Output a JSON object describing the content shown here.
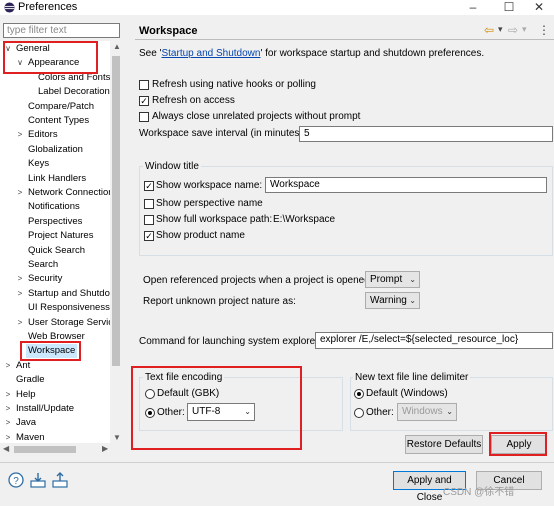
{
  "window": {
    "title": "Preferences",
    "minimize": "–",
    "maximize": "☐",
    "close": "✕"
  },
  "filter": {
    "placeholder": "type filter text"
  },
  "tree": [
    {
      "label": "General",
      "chev": "∨",
      "level": 0
    },
    {
      "label": "Appearance",
      "chev": "∨",
      "level": 1
    },
    {
      "label": "Colors and Fonts",
      "chev": "",
      "level": 2
    },
    {
      "label": "Label Decorations",
      "chev": "",
      "level": 2
    },
    {
      "label": "Compare/Patch",
      "chev": "",
      "level": 1
    },
    {
      "label": "Content Types",
      "chev": "",
      "level": 1
    },
    {
      "label": "Editors",
      "chev": ">",
      "level": 1
    },
    {
      "label": "Globalization",
      "chev": "",
      "level": 1
    },
    {
      "label": "Keys",
      "chev": "",
      "level": 1
    },
    {
      "label": "Link Handlers",
      "chev": "",
      "level": 1
    },
    {
      "label": "Network Connections",
      "chev": ">",
      "level": 1
    },
    {
      "label": "Notifications",
      "chev": "",
      "level": 1
    },
    {
      "label": "Perspectives",
      "chev": "",
      "level": 1
    },
    {
      "label": "Project Natures",
      "chev": "",
      "level": 1
    },
    {
      "label": "Quick Search",
      "chev": "",
      "level": 1
    },
    {
      "label": "Search",
      "chev": "",
      "level": 1
    },
    {
      "label": "Security",
      "chev": ">",
      "level": 1
    },
    {
      "label": "Startup and Shutdown",
      "chev": ">",
      "level": 1
    },
    {
      "label": "UI Responsiveness",
      "chev": "",
      "level": 1
    },
    {
      "label": "User Storage Service",
      "chev": ">",
      "level": 1
    },
    {
      "label": "Web Browser",
      "chev": "",
      "level": 1
    },
    {
      "label": "Workspace",
      "chev": "",
      "level": 1,
      "selected": true
    },
    {
      "label": "Ant",
      "chev": ">",
      "level": 0
    },
    {
      "label": "Gradle",
      "chev": "",
      "level": 0
    },
    {
      "label": "Help",
      "chev": ">",
      "level": 0
    },
    {
      "label": "Install/Update",
      "chev": ">",
      "level": 0
    },
    {
      "label": "Java",
      "chev": ">",
      "level": 0
    },
    {
      "label": "Maven",
      "chev": ">",
      "level": 0
    }
  ],
  "page": {
    "title": "Workspace",
    "nav": {
      "back": "⇦",
      "back_menu": "▾",
      "fwd": "⇨",
      "fwd_menu": "▾",
      "menu": "⋮"
    },
    "see_prefix": "See '",
    "see_link": "Startup and Shutdown",
    "see_suffix": "' for workspace startup and shutdown preferences.",
    "refresh_hooks": "Refresh using native hooks or polling",
    "refresh_access": "Refresh on access",
    "close_unrelated": "Always close unrelated projects without prompt",
    "save_interval_label": "Workspace save interval (in minutes):",
    "save_interval_value": "5"
  },
  "window_title_group": {
    "label": "Window title",
    "show_name": "Show workspace name:",
    "name_value": "Workspace",
    "show_perspective": "Show perspective name",
    "show_path": "Show full workspace path:",
    "path_value": "E:\\Workspace",
    "show_product": "Show product name"
  },
  "open_referenced": {
    "label": "Open referenced projects when a project is opened:",
    "value": "Prompt"
  },
  "unknown_nature": {
    "label": "Report unknown project nature as:",
    "value": "Warning"
  },
  "explorer": {
    "label": "Command for launching system explorer:",
    "value": "explorer /E,/select=${selected_resource_loc}"
  },
  "encoding": {
    "label": "Text file encoding",
    "default": "Default (GBK)",
    "other": "Other:",
    "other_value": "UTF-8"
  },
  "delimiter": {
    "label": "New text file line delimiter",
    "default": "Default (Windows)",
    "other": "Other:",
    "other_value": "Windows"
  },
  "buttons": {
    "restore": "Restore Defaults",
    "apply": "Apply",
    "apply_close": "Apply and Close",
    "cancel": "Cancel"
  },
  "icons": {
    "help": "help-icon",
    "import": "import-icon",
    "export": "export-icon"
  },
  "watermark": "CSDN @徐不错",
  "colors": {
    "highlight": "#e02020",
    "link": "#0645ad",
    "selection": "#cce8ff"
  }
}
